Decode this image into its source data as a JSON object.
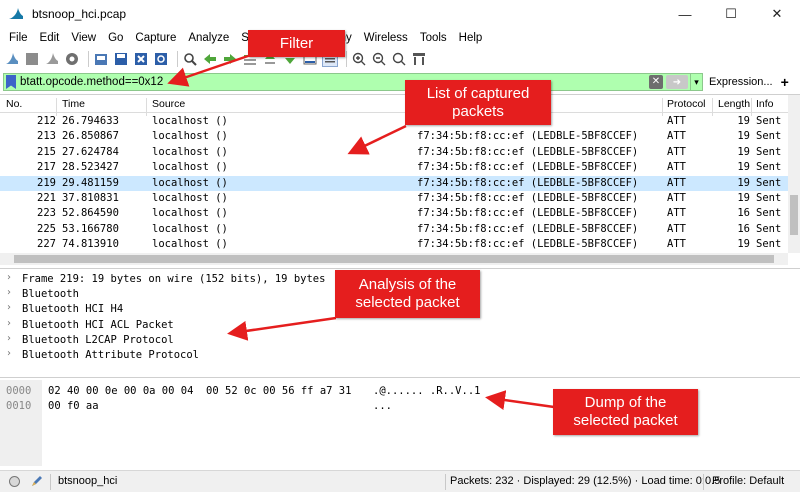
{
  "window": {
    "title": "btsnoop_hci.pcap",
    "minimize": "—",
    "maximize": "☐",
    "close": "✕"
  },
  "menu": [
    "File",
    "Edit",
    "View",
    "Go",
    "Capture",
    "Analyze",
    "Statistics",
    "Telephony",
    "Wireless",
    "Tools",
    "Help"
  ],
  "filter": {
    "value": "btatt.opcode.method==0x12",
    "expression_label": "Expression...",
    "plus_label": "+",
    "bg_color": "#afffaf"
  },
  "packet_list": {
    "columns": [
      "No.",
      "Time",
      "Source",
      "Protocol",
      "Length",
      "Info"
    ],
    "rows": [
      {
        "no": "212",
        "time": "26.794633",
        "source": "localhost ()",
        "destination": "",
        "protocol": "ATT",
        "length": "19",
        "info": "Sent"
      },
      {
        "no": "213",
        "time": "26.850867",
        "source": "localhost ()",
        "destination": "f7:34:5b:f8:cc:ef (LEDBLE-5BF8CCEF)",
        "protocol": "ATT",
        "length": "19",
        "info": "Sent"
      },
      {
        "no": "215",
        "time": "27.624784",
        "source": "localhost ()",
        "destination": "f7:34:5b:f8:cc:ef (LEDBLE-5BF8CCEF)",
        "protocol": "ATT",
        "length": "19",
        "info": "Sent"
      },
      {
        "no": "217",
        "time": "28.523427",
        "source": "localhost ()",
        "destination": "f7:34:5b:f8:cc:ef (LEDBLE-5BF8CCEF)",
        "protocol": "ATT",
        "length": "19",
        "info": "Sent"
      },
      {
        "no": "219",
        "time": "29.481159",
        "source": "localhost ()",
        "destination": "f7:34:5b:f8:cc:ef (LEDBLE-5BF8CCEF)",
        "protocol": "ATT",
        "length": "19",
        "info": "Sent",
        "selected": true
      },
      {
        "no": "221",
        "time": "37.810831",
        "source": "localhost ()",
        "destination": "f7:34:5b:f8:cc:ef (LEDBLE-5BF8CCEF)",
        "protocol": "ATT",
        "length": "19",
        "info": "Sent"
      },
      {
        "no": "223",
        "time": "52.864590",
        "source": "localhost ()",
        "destination": "f7:34:5b:f8:cc:ef (LEDBLE-5BF8CCEF)",
        "protocol": "ATT",
        "length": "16",
        "info": "Sent"
      },
      {
        "no": "225",
        "time": "53.166780",
        "source": "localhost ()",
        "destination": "f7:34:5b:f8:cc:ef (LEDBLE-5BF8CCEF)",
        "protocol": "ATT",
        "length": "16",
        "info": "Sent"
      },
      {
        "no": "227",
        "time": "74.813910",
        "source": "localhost ()",
        "destination": "f7:34:5b:f8:cc:ef (LEDBLE-5BF8CCEF)",
        "protocol": "ATT",
        "length": "19",
        "info": "Sent"
      }
    ],
    "selected_color": "#cce8ff"
  },
  "details": [
    "Frame 219: 19 bytes on wire (152 bits), 19 bytes",
    "Bluetooth",
    "Bluetooth HCI H4",
    "Bluetooth HCI ACL Packet",
    "Bluetooth L2CAP Protocol",
    "Bluetooth Attribute Protocol"
  ],
  "hex": [
    {
      "offset": "0000",
      "bytes": "02 40 00 0e 00 0a 00 04  00 52 0c 00 56 ff a7 31",
      "ascii": ".@...... .R..V..1"
    },
    {
      "offset": "0010",
      "bytes": "00 f0 aa",
      "ascii": "..."
    }
  ],
  "status": {
    "file": "btsnoop_hci",
    "packets": "Packets: 232 · Displayed: 29 (12.5%) · Load time: 0:0.5",
    "profile": "Profile: Default"
  },
  "annotations": {
    "filter": "Filter",
    "list": [
      "List of captured",
      "packets"
    ],
    "analysis": [
      "Analysis of the",
      "selected packet"
    ],
    "dump": [
      "Dump of the",
      "selected packet"
    ],
    "color": "#e51e1e"
  }
}
